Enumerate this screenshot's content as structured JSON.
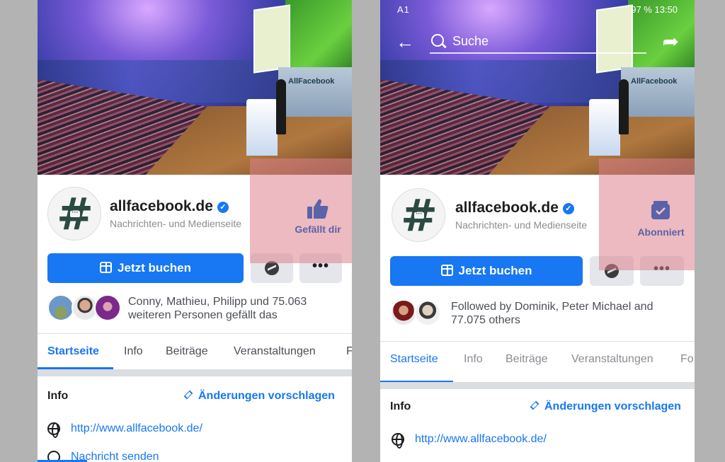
{
  "left": {
    "page_name": "allfacebook.de",
    "category": "Nachrichten- und Medienseite",
    "like_label": "Gefällt dir",
    "book_button": "Jetzt buchen",
    "social_line1": "Conny, Mathieu, Philipp und 75.063",
    "social_line2": "weiteren Personen gefällt das",
    "tabs": [
      "Startseite",
      "Info",
      "Beiträge",
      "Veranstaltungen",
      "F"
    ],
    "info_title": "Info",
    "suggest_label": "Änderungen vorschlagen",
    "website": "http://www.allfacebook.de/",
    "message": "Nachricht senden",
    "stage_logo": "AllFacebook"
  },
  "right": {
    "status_left": "A1",
    "status_right": "97 %  13:50",
    "search_placeholder": "Suche",
    "page_name": "allfacebook.de",
    "category": "Nachrichten- und Medienseite",
    "subscribed_label": "Abonniert",
    "book_button": "Jetzt buchen",
    "social_line1": "Followed by Dominik, Peter Michael and",
    "social_line2": "77.075 others",
    "tabs": [
      "Startseite",
      "Info",
      "Beiträge",
      "Veranstaltungen",
      "Fo"
    ],
    "info_title": "Info",
    "suggest_label": "Änderungen vorschlagen",
    "website": "http://www.allfacebook.de/",
    "stage_logo": "AllFacebook"
  },
  "colors": {
    "facebook_blue": "#1877f2",
    "overlay": "#dc828c",
    "accent_purple": "#5b62a8"
  }
}
